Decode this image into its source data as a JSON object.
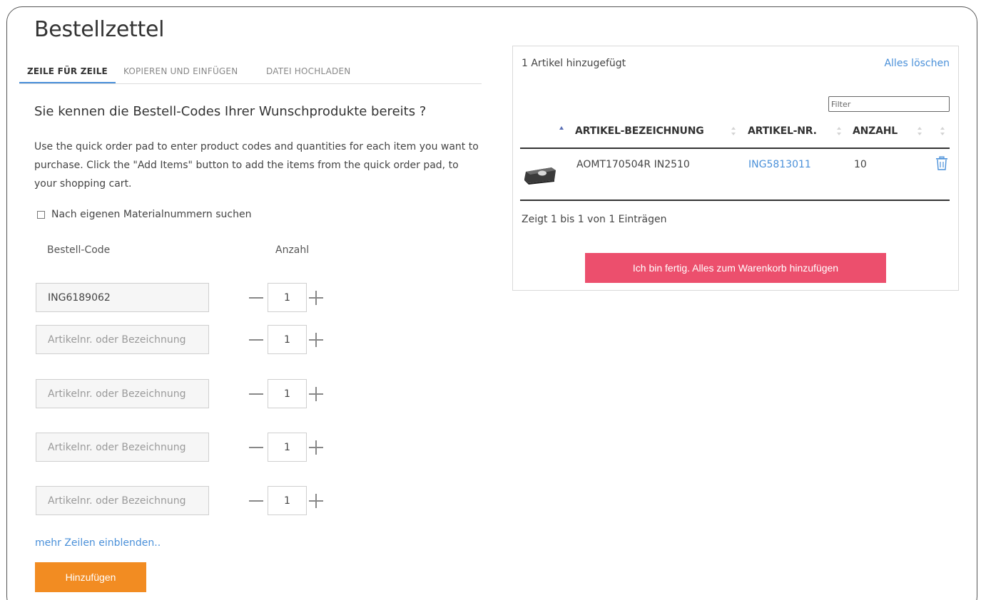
{
  "page": {
    "title": "Bestellzettel"
  },
  "tabs": [
    {
      "label": "ZEILE FÜR ZEILE",
      "active": true
    },
    {
      "label": "KOPIEREN UND EINFÜGEN",
      "active": false
    },
    {
      "label": "DATEI HOCHLADEN",
      "active": false
    }
  ],
  "intro": {
    "headline": "Sie kennen die Bestell-Codes Ihrer Wunschprodukte bereits ?",
    "description": "Use the quick order pad to enter product codes and quantities for each item you want to purchase. Click the \"Add Items\" button to add the items from the quick order pad, to your shopping cart."
  },
  "own_material_checkbox": {
    "label": "Nach eigenen Materialnummern suchen",
    "checked": false
  },
  "order_form": {
    "code_header": "Bestell-Code",
    "qty_header": "Anzahl",
    "rows": [
      {
        "code": "ING6189062",
        "placeholder": "Artikelnr. oder Bezeichnung",
        "qty": "1"
      },
      {
        "code": "",
        "placeholder": "Artikelnr. oder Bezeichnung",
        "qty": "1"
      },
      {
        "code": "",
        "placeholder": "Artikelnr. oder Bezeichnung",
        "qty": "1"
      },
      {
        "code": "",
        "placeholder": "Artikelnr. oder Bezeichnung",
        "qty": "1"
      },
      {
        "code": "",
        "placeholder": "Artikelnr. oder Bezeichnung",
        "qty": "1"
      }
    ],
    "more_rows_link": "mehr Zeilen einblenden..",
    "add_button": "Hinzufügen"
  },
  "cart_panel": {
    "count_text": "1 Artikel hinzugefügt",
    "clear_all": "Alles löschen",
    "filter_placeholder": "Filter",
    "columns": [
      "ARTIKEL-BEZEICHNUNG",
      "ARTIKEL-NR.",
      "ANZAHL"
    ],
    "items": [
      {
        "name": "AOMT170504R IN2510",
        "number": "ING5813011",
        "qty": "10",
        "thumb_icon": "insert-product-icon"
      }
    ],
    "entries_info": "Zeigt 1 bis 1 von 1 Einträgen",
    "finish_button": "Ich bin fertig. Alles zum Warenkorb hinzufügen"
  },
  "colors": {
    "accent_blue": "#4a90d9",
    "add_button_orange": "#f28c22",
    "finish_button_pink": "#ec4f6d"
  }
}
